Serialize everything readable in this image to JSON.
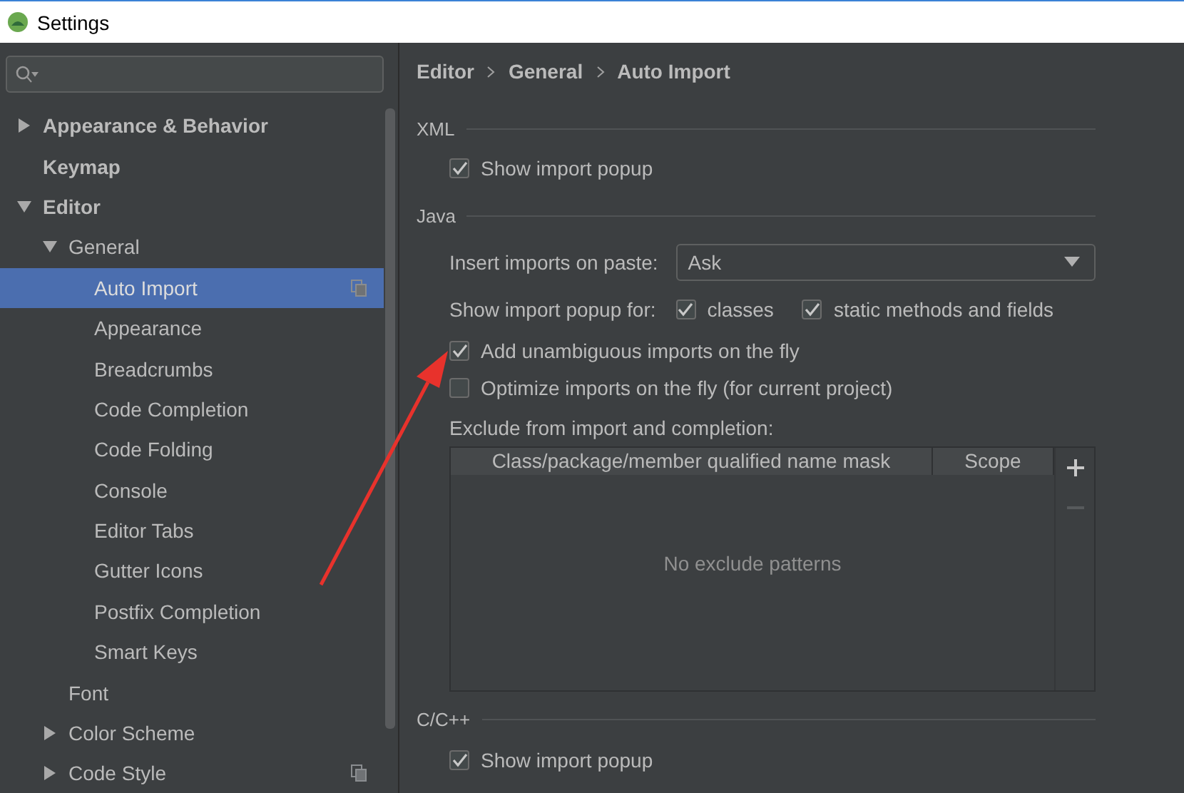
{
  "window": {
    "title": "Settings"
  },
  "sidebar": {
    "tree": [
      {
        "label": "Appearance & Behavior",
        "bold": true,
        "expanded": false,
        "selected": false
      },
      {
        "label": "Keymap",
        "bold": true,
        "selected": false
      },
      {
        "label": "Editor",
        "bold": true,
        "expanded": true,
        "selected": false,
        "children": [
          {
            "label": "General",
            "bold": false,
            "expanded": true,
            "selected": false,
            "children": [
              {
                "label": "Auto Import",
                "bold": false,
                "selected": true,
                "project_level": true
              },
              {
                "label": "Appearance",
                "bold": false,
                "selected": false
              },
              {
                "label": "Breadcrumbs",
                "bold": false,
                "selected": false
              },
              {
                "label": "Code Completion",
                "bold": false,
                "selected": false
              },
              {
                "label": "Code Folding",
                "bold": false,
                "selected": false
              },
              {
                "label": "Console",
                "bold": false,
                "selected": false
              },
              {
                "label": "Editor Tabs",
                "bold": false,
                "selected": false
              },
              {
                "label": "Gutter Icons",
                "bold": false,
                "selected": false
              },
              {
                "label": "Postfix Completion",
                "bold": false,
                "selected": false
              },
              {
                "label": "Smart Keys",
                "bold": false,
                "selected": false
              }
            ]
          },
          {
            "label": "Font",
            "bold": false,
            "selected": false
          },
          {
            "label": "Color Scheme",
            "bold": false,
            "expanded": false,
            "selected": false
          },
          {
            "label": "Code Style",
            "bold": false,
            "expanded": false,
            "selected": false,
            "project_level": true
          }
        ]
      }
    ]
  },
  "breadcrumb": [
    "Editor",
    "General",
    "Auto Import"
  ],
  "sections": [
    {
      "title": "XML",
      "rows": [
        {
          "kind": "checkbox",
          "label": "Show import popup",
          "checked": true
        }
      ]
    },
    {
      "title": "Java",
      "rows": [
        {
          "kind": "dropdown",
          "label": "Insert imports on paste:",
          "value": "Ask"
        },
        {
          "kind": "checkgroup",
          "label": "Show import popup for:",
          "options": [
            {
              "label": "classes",
              "checked": true
            },
            {
              "label": "static methods and fields",
              "checked": true
            }
          ]
        },
        {
          "kind": "checkbox",
          "label": "Add unambiguous imports on the fly",
          "checked": true
        },
        {
          "kind": "checkbox",
          "label": "Optimize imports on the fly (for current project)",
          "checked": false
        },
        {
          "kind": "table",
          "label": "Exclude from import and completion:",
          "columns": [
            "Class/package/member qualified name mask",
            "Scope"
          ],
          "empty_text": "No exclude patterns"
        }
      ]
    },
    {
      "title": "C/C++",
      "rows": [
        {
          "kind": "checkbox",
          "label": "Show import popup",
          "checked": true
        }
      ]
    }
  ]
}
